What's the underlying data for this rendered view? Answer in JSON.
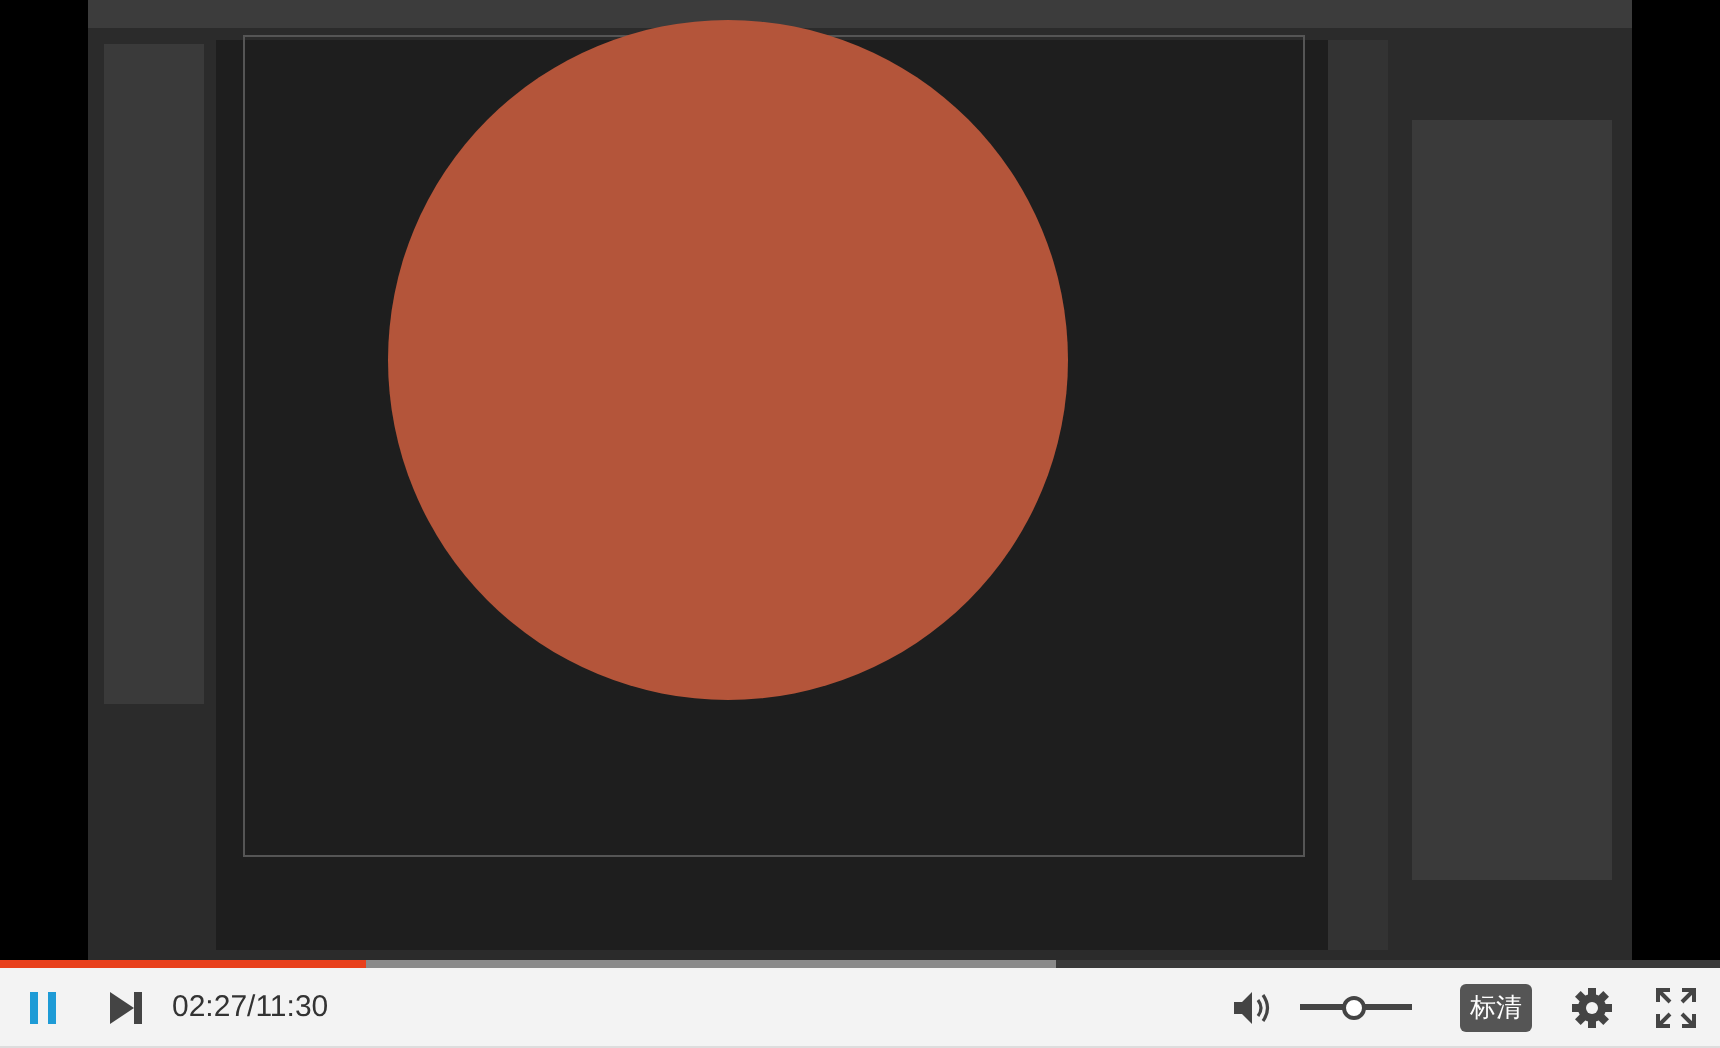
{
  "player": {
    "progress": {
      "level": 0.213,
      "buffered": {
        "level": 0.614
      }
    },
    "playing": true,
    "time": "02:27/11:30",
    "volume": {
      "level": 0.5
    },
    "quality": "标清"
  }
}
